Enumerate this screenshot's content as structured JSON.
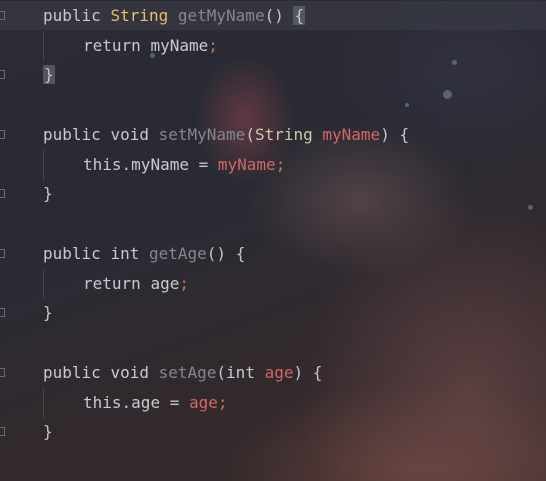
{
  "code": {
    "line1": {
      "kw": "public",
      "type": "String",
      "method": "getMyName",
      "parens": "()",
      "brace": "{"
    },
    "line2": {
      "kw": "return",
      "field": "myName",
      "semi": ";"
    },
    "line3": {
      "brace": "}"
    },
    "line5": {
      "kw": "public",
      "kw2": "void",
      "method": "setMyName",
      "open": "(",
      "ptype": "String",
      "param": "myName",
      "close": ")",
      "brace": "{"
    },
    "line6": {
      "this": "this",
      "dot": ".",
      "field": "myName",
      "eq": "=",
      "param": "myName",
      "semi": ";"
    },
    "line7": {
      "brace": "}"
    },
    "line9": {
      "kw": "public",
      "kw2": "int",
      "method": "getAge",
      "parens": "()",
      "brace": "{"
    },
    "line10": {
      "kw": "return",
      "field": "age",
      "semi": ";"
    },
    "line11": {
      "brace": "}"
    },
    "line13": {
      "kw": "public",
      "kw2": "void",
      "method": "setAge",
      "open": "(",
      "ptype": "int",
      "param": "age",
      "close": ")",
      "brace": "{"
    },
    "line14": {
      "this": "this",
      "dot": ".",
      "field": "age",
      "eq": "=",
      "param": "age",
      "semi": ";"
    },
    "line15": {
      "brace": "}"
    }
  },
  "theme": {
    "keyword": "#c7c9cf",
    "type": "#e8bf6a",
    "method": "#848690",
    "parameter": "#d06868",
    "semicolon": "#c27a46"
  }
}
